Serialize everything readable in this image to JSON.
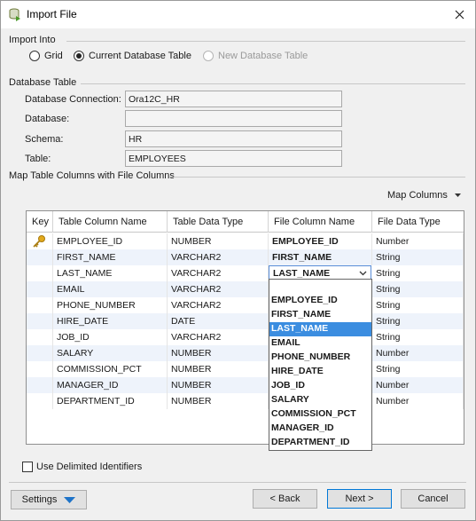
{
  "window": {
    "title": "Import File"
  },
  "import_into": {
    "label": "Import Into",
    "options": [
      {
        "label": "Grid",
        "selected": false,
        "disabled": false
      },
      {
        "label": "Current Database Table",
        "selected": true,
        "disabled": false
      },
      {
        "label": "New Database Table",
        "selected": false,
        "disabled": true
      }
    ]
  },
  "database_table": {
    "label": "Database Table",
    "fields": [
      {
        "label": "Database Connection:",
        "value": "Ora12C_HR"
      },
      {
        "label": "Database:",
        "value": ""
      },
      {
        "label": "Schema:",
        "value": "HR"
      },
      {
        "label": "Table:",
        "value": "EMPLOYEES"
      }
    ]
  },
  "mapping": {
    "label": "Map Table Columns with File Columns",
    "map_columns_label": "Map Columns",
    "columns": [
      "Key",
      "Table Column Name",
      "Table Data Type",
      "File Column Name",
      "File Data Type"
    ],
    "rows": [
      {
        "key": true,
        "name": "EMPLOYEE_ID",
        "type": "NUMBER",
        "file_col": "EMPLOYEE_ID",
        "file_type": "Number"
      },
      {
        "key": false,
        "name": "FIRST_NAME",
        "type": "VARCHAR2",
        "file_col": "FIRST_NAME",
        "file_type": "String"
      },
      {
        "key": false,
        "name": "LAST_NAME",
        "type": "VARCHAR2",
        "file_col": "LAST_NAME",
        "file_type": "String"
      },
      {
        "key": false,
        "name": "EMAIL",
        "type": "VARCHAR2",
        "file_col": "",
        "file_type": "String"
      },
      {
        "key": false,
        "name": "PHONE_NUMBER",
        "type": "VARCHAR2",
        "file_col": "",
        "file_type": "String"
      },
      {
        "key": false,
        "name": "HIRE_DATE",
        "type": "DATE",
        "file_col": "",
        "file_type": "String"
      },
      {
        "key": false,
        "name": "JOB_ID",
        "type": "VARCHAR2",
        "file_col": "",
        "file_type": "String"
      },
      {
        "key": false,
        "name": "SALARY",
        "type": "NUMBER",
        "file_col": "",
        "file_type": "Number"
      },
      {
        "key": false,
        "name": "COMMISSION_PCT",
        "type": "NUMBER",
        "file_col": "",
        "file_type": "String"
      },
      {
        "key": false,
        "name": "MANAGER_ID",
        "type": "NUMBER",
        "file_col": "",
        "file_type": "Number"
      },
      {
        "key": false,
        "name": "DEPARTMENT_ID",
        "type": "NUMBER",
        "file_col": "",
        "file_type": "Number"
      }
    ],
    "dropdown": {
      "current": "LAST_NAME",
      "options": [
        "",
        "EMPLOYEE_ID",
        "FIRST_NAME",
        "LAST_NAME",
        "EMAIL",
        "PHONE_NUMBER",
        "HIRE_DATE",
        "JOB_ID",
        "SALARY",
        "COMMISSION_PCT",
        "MANAGER_ID",
        "DEPARTMENT_ID"
      ],
      "selected_index": 3
    }
  },
  "options": {
    "delimited_label": "Use Delimited Identifiers"
  },
  "buttons": {
    "settings": "Settings",
    "back": "< Back",
    "next": "Next >",
    "cancel": "Cancel"
  },
  "colors": {
    "selection": "#3b8de0",
    "accent": "#0078d7",
    "key_icon": "#e2a91c"
  }
}
